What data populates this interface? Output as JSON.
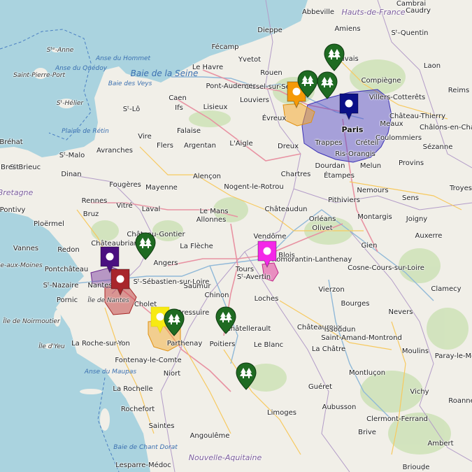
{
  "map": {
    "colors": {
      "land": "#f1efe8",
      "sea": "#aad3df",
      "forest": "#c8e0b0",
      "road_major": "#f7c95f",
      "road_motorway": "#e892a2",
      "boundary": "#9b7fb3",
      "water_text": "#3a6fb0"
    },
    "sea_labels": [
      "Anse du Hommet",
      "Baie de la Seine",
      "Anse du Quédoy",
      "Baie des Veys",
      "Plaine de Rétin",
      "Anse du Maupas",
      "Baie de Chant Dorat"
    ],
    "region_labels": [
      "Hauts-de-France",
      "Bretagne",
      "Nouvelle-Aquitaine"
    ],
    "island_labels": [
      "Sᵗᵉ-Anne",
      "Saint-Pierre-Port",
      "Sᵗ-Hélier",
      "Île de Nantes",
      "Île de Noirmoutier",
      "Île d'Yeu",
      "Île-aux-Moines"
    ],
    "towns": [
      "Abbeville",
      "Cambrai",
      "Caudry",
      "Amiens",
      "Sᵗ-Quentin",
      "Dieppe",
      "Fécamp",
      "Yvetot",
      "Le Havre",
      "Rouen",
      "Oissel-sur-Seine",
      "Pont-Audemer",
      "Beauvais",
      "Compiègne",
      "Laon",
      "Reims",
      "Caen",
      "Ifs",
      "Lisieux",
      "Louviers",
      "Sᵗ-Lô",
      "Évreux",
      "Villers-Cotterêts",
      "Château-Thierry",
      "Meaux",
      "Coulommiers",
      "Sézanne",
      "Provins",
      "Trappes",
      "Créteil",
      "Ris-Orangis",
      "Melun",
      "Dourdan",
      "Étampes",
      "Nemours",
      "Troyes",
      "Vire",
      "Falaise",
      "Flers",
      "Argentan",
      "L'Aigle",
      "Dreux",
      "Chartres",
      "Avranches",
      "Sᵗ-Malo",
      "Dinan",
      "Sᵗ-Brieuc",
      "Fougères",
      "Mayenne",
      "Alençon",
      "Nogent-le-Rotrou",
      "Rennes",
      "Vitré",
      "Laval",
      "Le Mans",
      "Allonnes",
      "Châteaudun",
      "Orléans",
      "Olivet",
      "Pithiviers",
      "Montargis",
      "Sens",
      "Joigny",
      "Auxerre",
      "Pontivy",
      "Ploërmel",
      "Bruz",
      "Châteaubriant",
      "Château-Gontier",
      "La Flèche",
      "Angers",
      "Vendôme",
      "Blois",
      "Gien",
      "Vannes",
      "Redon",
      "Pontchâteau",
      "Sᵗ-Nazaire",
      "Nantes",
      "Sᵗ-Sébastien-sur-Loire",
      "Tours",
      "Sᵗ-Avertin",
      "Romorantin-Lanthenay",
      "Vierzon",
      "Cosne-Cours-sur-Loire",
      "Clamecy",
      "Saumur",
      "Chinon",
      "Loches",
      "Bourges",
      "Pornic",
      "Cholet",
      "Bressuire",
      "Châtellerault",
      "Châteauroux",
      "Nevers",
      "La Roche-sur-Yon",
      "Parthenay",
      "Poitiers",
      "Le Blanc",
      "Issoudun",
      "Saint-Amand-Montrond",
      "La Châtre",
      "Moulins",
      "Fontenay-le-Comte",
      "Niort",
      "Montluçon",
      "La Rochelle",
      "Guéret",
      "Vichy",
      "Rochefort",
      "Saintes",
      "Aubusson",
      "Limoges",
      "Clermont-Ferrand",
      "Roanne",
      "Angoulême",
      "Brive",
      "Ambert",
      "Lesparre-Médoc",
      "Paris",
      "Brest",
      "Paray-le-Monial",
      "Bréhat",
      "Châlons-en-Champagne",
      "Briouḍe"
    ],
    "poly_colors": [
      "#4b40c8",
      "#f5a623",
      "#c23b3b",
      "#7d3fa0",
      "#f0e020",
      "#e0409f"
    ],
    "pins": [
      {
        "name": "marker-blue",
        "color": "#0b1088",
        "icon": "dot-icon"
      },
      {
        "name": "marker-orange",
        "color": "#f59a08",
        "icon": "dot-icon"
      },
      {
        "name": "marker-purple",
        "color": "#4a1080",
        "icon": "dot-icon"
      },
      {
        "name": "marker-red",
        "color": "#a8262c",
        "icon": "dot-icon"
      },
      {
        "name": "marker-yellow",
        "color": "#f7ea13",
        "icon": "dot-icon"
      },
      {
        "name": "marker-magenta",
        "color": "#f428e8",
        "icon": "dot-icon"
      },
      {
        "name": "marker-forest-1",
        "color": "#1f6b22",
        "icon": "trees-icon"
      },
      {
        "name": "marker-forest-2",
        "color": "#1f6b22",
        "icon": "trees-icon"
      },
      {
        "name": "marker-forest-3",
        "color": "#1f6b22",
        "icon": "trees-icon"
      },
      {
        "name": "marker-forest-4",
        "color": "#1f6b22",
        "icon": "trees-icon"
      },
      {
        "name": "marker-forest-5",
        "color": "#1f6b22",
        "icon": "trees-icon"
      },
      {
        "name": "marker-forest-6",
        "color": "#1f6b22",
        "icon": "trees-icon"
      },
      {
        "name": "marker-forest-7",
        "color": "#1f6b22",
        "icon": "trees-icon"
      }
    ]
  }
}
